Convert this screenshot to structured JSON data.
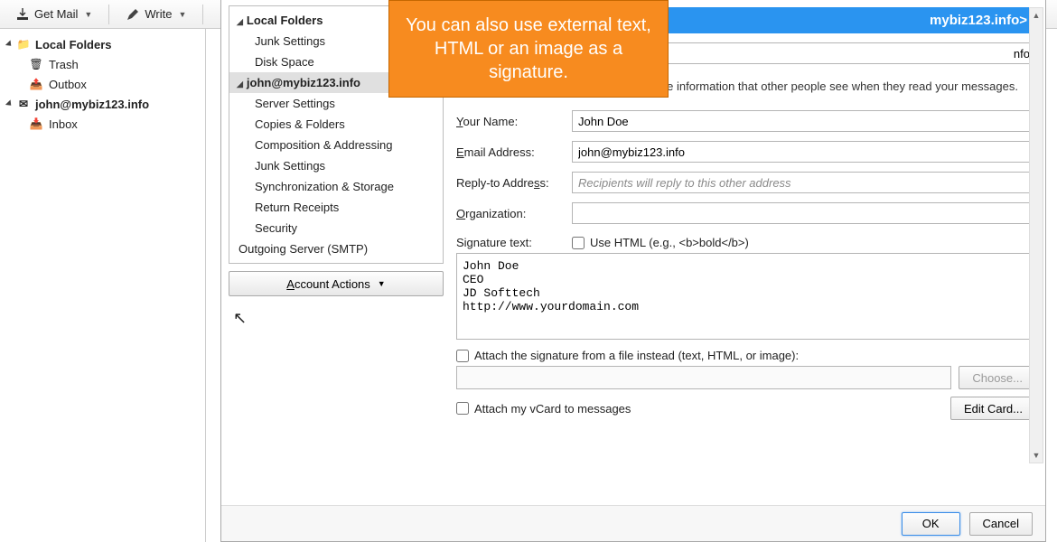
{
  "toolbar": {
    "get_mail": "Get Mail",
    "write": "Write"
  },
  "sidebar": {
    "local": "Local Folders",
    "trash": "Trash",
    "outbox": "Outbox",
    "account": "john@mybiz123.info",
    "inbox": "Inbox"
  },
  "tree": {
    "local": "Local Folders",
    "items_local": [
      "Junk Settings",
      "Disk Space"
    ],
    "account": "john@mybiz123.info",
    "items_acct": [
      "Server Settings",
      "Copies & Folders",
      "Composition & Addressing",
      "Junk Settings",
      "Synchronization & Storage",
      "Return Receipts",
      "Security"
    ],
    "smtp": "Outgoing Server (SMTP)",
    "actions": "Account Actions"
  },
  "pane": {
    "header_suffix": "mybiz123.info>",
    "account_name_value": "nfo",
    "desc": "Each account has an identity, which is the information that other people see when they read your messages.",
    "your_name": "Your Name:",
    "your_name_val": "John Doe",
    "email": "Email Address:",
    "email_val": "john@mybiz123.info",
    "reply": "Reply-to Address:",
    "reply_ph": "Recipients will reply to this other address",
    "org": "Organization:",
    "sig_label": "Signature text:",
    "use_html": "Use HTML (e.g., <b>bold</b>)",
    "sig_text": "John Doe\nCEO\nJD Softtech\nhttp://www.yourdomain.com",
    "attach_file": "Attach the signature from a file instead (text, HTML, or image):",
    "choose": "Choose...",
    "vcard": "Attach my vCard to messages",
    "edit_card": "Edit Card...",
    "ok": "OK",
    "cancel": "Cancel"
  },
  "callout": "You can also use external text, HTML or an image as a signature."
}
